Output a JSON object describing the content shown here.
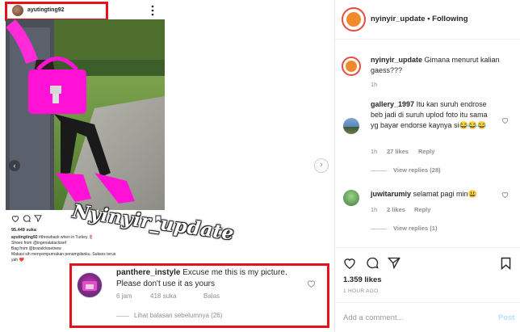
{
  "left_screenshot": {
    "username": "ayutingting92",
    "likes": "95.449 suka",
    "caption_user": "ayutingting92",
    "caption_lines": [
      "#throwback when in Turkey 🌷",
      "Shoes from @ingenatalaclosef",
      "Bag from @brandclosetnew",
      "Makasi sih menyempurnakan penampilanku. Sukses terus",
      "yah ❤️"
    ]
  },
  "watermark": "Nyinyir_update",
  "highlight_comment": {
    "username": "panthere_instyle",
    "text": "Excuse me this is my picture. Please don't use it as yours",
    "time": "6 jam",
    "likes": "418 suka",
    "reply": "Balas",
    "view_previous": "Lihat balasan sebelumnya (26)"
  },
  "post": {
    "author": "nyinyir_update",
    "following": "• Following",
    "caption_user": "nyinyir_update",
    "caption_text": "Gimana menurut kalian gaess???",
    "caption_time": "1h",
    "comments": [
      {
        "user": "gallery_1997",
        "text": "Itu kan suruh endrose beb jadi di suruh uplod foto itu sama yg bayar endorse kaynya si😂😂😂",
        "time": "1h",
        "likes": "27 likes",
        "reply": "Reply",
        "view_replies": "View replies (28)"
      },
      {
        "user": "juwitarumiy",
        "text": "selamat pagi min😃",
        "time": "1h",
        "likes": "2 likes",
        "reply": "Reply",
        "view_replies": "View replies (1)"
      }
    ],
    "likes_count": "1.359 likes",
    "time_ago": "1 HOUR AGO",
    "add_comment_placeholder": "Add a comment...",
    "post_button": "Post"
  },
  "colors": {
    "highlight_red": "#e3121b",
    "bag_magenta": "#ff12d6",
    "link_blue": "#3897f0"
  }
}
